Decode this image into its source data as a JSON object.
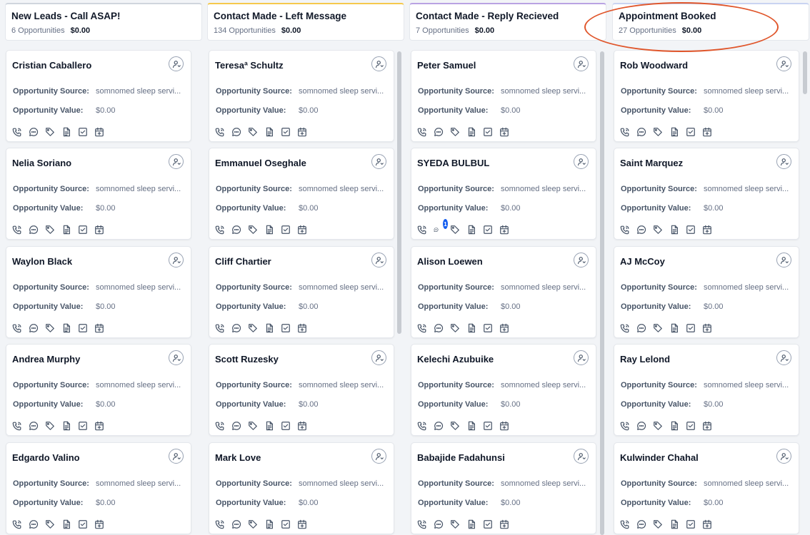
{
  "accent": "#155eef",
  "annotation_color": "#e0562b",
  "labels": {
    "source": "Opportunity Source:",
    "value": "Opportunity Value:"
  },
  "card_icons": [
    "phone-icon",
    "chat-icon",
    "tag-icon",
    "note-icon",
    "task-icon",
    "calendar-icon"
  ],
  "columns": [
    {
      "title": "New Leads - Call ASAP!",
      "count": "6 Opportunities",
      "value": "$0.00",
      "top_color": "#d0d5dd",
      "cards": [
        {
          "name": "Cristian Caballero",
          "source": "somnomed sleep servi...",
          "value": "$0.00"
        },
        {
          "name": "Nelia Soriano",
          "source": "somnomed sleep servi...",
          "value": "$0.00"
        },
        {
          "name": "Waylon Black",
          "source": "somnomed sleep servi...",
          "value": "$0.00"
        },
        {
          "name": "Andrea Murphy",
          "source": "somnomed sleep servi...",
          "value": "$0.00"
        },
        {
          "name": "Edgardo Valino",
          "source": "somnomed sleep servi...",
          "value": "$0.00"
        }
      ]
    },
    {
      "title": "Contact Made - Left Message",
      "count": "134 Opportunities",
      "value": "$0.00",
      "top_color": "#f5c84c",
      "cards": [
        {
          "name": "Teresaª Schultz",
          "source": "somnomed sleep servi...",
          "value": "$0.00"
        },
        {
          "name": "Emmanuel Oseghale",
          "source": "somnomed sleep servi...",
          "value": "$0.00"
        },
        {
          "name": "Cliff Chartier",
          "source": "somnomed sleep servi...",
          "value": "$0.00"
        },
        {
          "name": "Scott Ruzesky",
          "source": "somnomed sleep servi...",
          "value": "$0.00"
        },
        {
          "name": "Mark Love",
          "source": "somnomed sleep servi...",
          "value": "$0.00"
        }
      ]
    },
    {
      "title": "Contact Made - Reply Recieved",
      "count": "7 Opportunities",
      "value": "$0.00",
      "top_color": "#b9a3e3",
      "cards": [
        {
          "name": "Peter Samuel",
          "source": "somnomed sleep servi...",
          "value": "$0.00"
        },
        {
          "name": "SYEDA BULBUL",
          "source": "somnomed sleep servi...",
          "value": "$0.00",
          "chat_badge": "1"
        },
        {
          "name": "Alison Loewen",
          "source": "somnomed sleep servi...",
          "value": "$0.00"
        },
        {
          "name": "Kelechi Azubuike",
          "source": "somnomed sleep servi...",
          "value": "$0.00"
        },
        {
          "name": "Babajide Fadahunsi",
          "source": "somnomed sleep servi...",
          "value": "$0.00"
        }
      ]
    },
    {
      "title": "Appointment Booked",
      "count": "27 Opportunities",
      "value": "$0.00",
      "top_color": "#c9d4f2",
      "cards": [
        {
          "name": "Rob Woodward",
          "source": "somnomed sleep servi...",
          "value": "$0.00"
        },
        {
          "name": "Saint Marquez",
          "source": "somnomed sleep servi...",
          "value": "$0.00"
        },
        {
          "name": "AJ McCoy",
          "source": "somnomed sleep servi...",
          "value": "$0.00"
        },
        {
          "name": "Ray Lelond",
          "source": "somnomed sleep servi...",
          "value": "$0.00"
        },
        {
          "name": "Kulwinder Chahal",
          "source": "somnomed sleep servi...",
          "value": "$0.00"
        }
      ]
    }
  ]
}
